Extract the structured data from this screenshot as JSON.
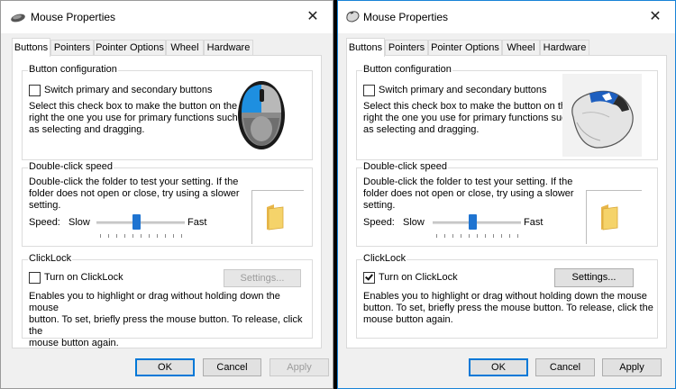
{
  "left_window": {
    "title": "Mouse Properties",
    "tabs": [
      "Buttons",
      "Pointers",
      "Pointer Options",
      "Wheel",
      "Hardware"
    ],
    "groups": {
      "button_config": {
        "label": "Button configuration",
        "checkbox_label": "Switch primary and secondary buttons",
        "checked": false,
        "description_lines": [
          "Select this check box to make the button on the",
          "right the one you use for primary functions such",
          "as selecting and dragging."
        ]
      },
      "double_click": {
        "label": "Double-click speed",
        "description_lines": [
          "Double-click the folder to test your setting. If the",
          "folder does not open or close, try using a slower",
          "setting."
        ],
        "speed_label": "Speed:",
        "slow_label": "Slow",
        "fast_label": "Fast",
        "slider_value": 0.45
      },
      "clicklock": {
        "label": "ClickLock",
        "checkbox_label": "Turn on ClickLock",
        "checked": false,
        "settings_label": "Settings...",
        "settings_enabled": false,
        "description_lines": [
          "Enables you to highlight or drag without holding down the mouse",
          "button. To set, briefly press the mouse button. To release, click the",
          "mouse button again."
        ]
      }
    },
    "buttons": {
      "ok": "OK",
      "cancel": "Cancel",
      "apply": "Apply"
    }
  },
  "right_window": {
    "title": "Mouse Properties",
    "tabs": [
      "Buttons",
      "Pointers",
      "Pointer Options",
      "Wheel",
      "Hardware"
    ],
    "groups": {
      "button_config": {
        "label": "Button configuration",
        "checkbox_label": "Switch primary and secondary buttons",
        "checked": false,
        "description_lines": [
          "Select this check box to make the button on the",
          "right the one you use for primary functions such",
          "as selecting and dragging."
        ]
      },
      "double_click": {
        "label": "Double-click speed",
        "description_lines": [
          "Double-click the folder to test your setting. If the",
          "folder does not open or close, try using a slower",
          "setting."
        ],
        "speed_label": "Speed:",
        "slow_label": "Slow",
        "fast_label": "Fast",
        "slider_value": 0.45
      },
      "clicklock": {
        "label": "ClickLock",
        "checkbox_label": "Turn on ClickLock",
        "checked": true,
        "settings_label": "Settings...",
        "settings_enabled": true,
        "description_lines": [
          "Enables you to highlight or drag without holding down the mouse",
          "button. To set, briefly press the mouse button. To release, click the",
          "mouse button again."
        ]
      }
    },
    "buttons": {
      "ok": "OK",
      "cancel": "Cancel",
      "apply": "Apply"
    }
  },
  "colors": {
    "accent": "#0078d7",
    "slider_thumb": "#1f74d1",
    "folder": "#f5d36a"
  },
  "icons": [
    "mouse-app-icon",
    "close-icon",
    "mouse-image-modern",
    "mouse-image-classic",
    "folder-icon"
  ]
}
